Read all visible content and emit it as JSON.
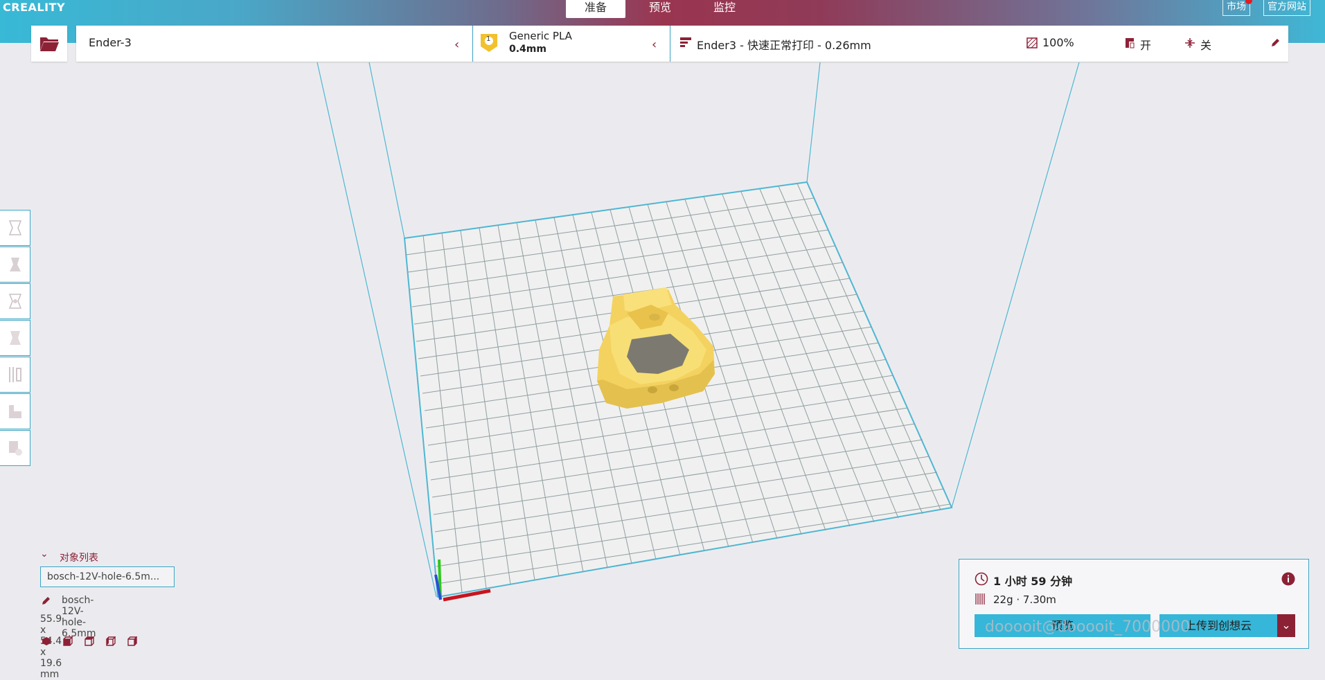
{
  "app": {
    "logo": "CREALITY"
  },
  "tabs": [
    {
      "label": "准备",
      "active": true
    },
    {
      "label": "预览",
      "active": false
    },
    {
      "label": "监控",
      "active": false
    }
  ],
  "topright": {
    "market": "市场",
    "official": "官方网站"
  },
  "machine": {
    "printer": "Ender-3",
    "extruder_index": "1",
    "material": "Generic PLA",
    "nozzle": "0.4mm",
    "profile": "Ender3 - 快速正常打印 - 0.26mm",
    "infill": "100%",
    "support": "开",
    "adhesion": "关"
  },
  "object_list": {
    "header": "对象列表",
    "item": "bosch-12V-hole-6.5m...",
    "selected_name": "bosch-12V-hole-6.5mm",
    "dimensions": "55.9 x 54.4 x 19.6 mm"
  },
  "print_info": {
    "time": "1 小时 59 分钟",
    "material_usage": "22g · 7.30m",
    "preview_button": "预览",
    "upload_button": "上传到创想云"
  },
  "watermark": "dooooit@dooooit_7000000",
  "colors": {
    "accent": "#3aa6c6",
    "brand": "#8c2136",
    "model": "#f6db6c"
  }
}
